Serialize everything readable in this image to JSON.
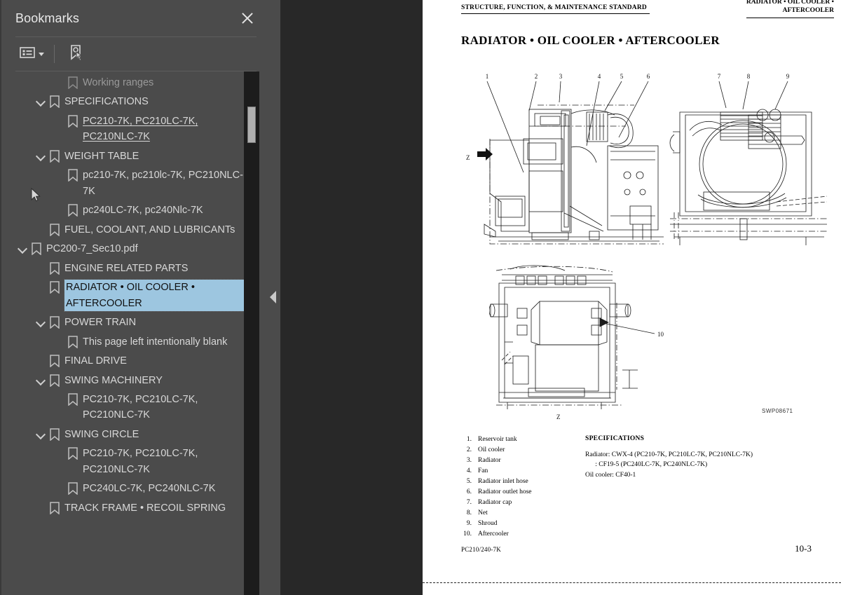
{
  "panel": {
    "title": "Bookmarks",
    "close_icon": "close-icon",
    "toolbar": {
      "options_icon": "list-options-icon",
      "options_chevron": "chevron-down-icon",
      "new_bookmark_icon": "new-bookmark-icon"
    }
  },
  "tree": [
    {
      "label": "Working ranges",
      "level": 1,
      "twisty": false,
      "selected": false,
      "underline": false,
      "faded": true
    },
    {
      "label": "SPECIFICATIONS",
      "level": 0,
      "twisty": true,
      "selected": false,
      "underline": false,
      "faded": false
    },
    {
      "label": "PC210-7K, PC210LC-7K, PC210NLC-7K",
      "level": 1,
      "twisty": false,
      "selected": false,
      "underline": true,
      "faded": false
    },
    {
      "label": "WEIGHT TABLE",
      "level": 0,
      "twisty": true,
      "selected": false,
      "underline": false,
      "faded": false
    },
    {
      "label": "pc210-7K, pc210lc-7K, PC210NLC-7K",
      "level": 1,
      "twisty": false,
      "selected": false,
      "underline": false,
      "faded": false
    },
    {
      "label": "pc240LC-7K, pc240Nlc-7K",
      "level": 1,
      "twisty": false,
      "selected": false,
      "underline": false,
      "faded": false
    },
    {
      "label": "FUEL, COOLANT, AND LUBRICANTs",
      "level": 0,
      "twisty": false,
      "selected": false,
      "underline": false,
      "faded": false
    },
    {
      "label": "PC200-7_Sec10.pdf",
      "level": -1,
      "twisty": true,
      "selected": false,
      "underline": false,
      "faded": false
    },
    {
      "label": "ENGINE RELATED PARTS",
      "level": 0,
      "twisty": false,
      "selected": false,
      "underline": false,
      "faded": false
    },
    {
      "label": "RADIATOR • OIL COOLER • AFTERCOOLER",
      "level": 0,
      "twisty": false,
      "selected": true,
      "underline": false,
      "faded": false
    },
    {
      "label": "POWER TRAIN",
      "level": 0,
      "twisty": true,
      "selected": false,
      "underline": false,
      "faded": false
    },
    {
      "label": "This page left intentionally blank",
      "level": 1,
      "twisty": false,
      "selected": false,
      "underline": false,
      "faded": false
    },
    {
      "label": "FINAL DRIVE",
      "level": 0,
      "twisty": false,
      "selected": false,
      "underline": false,
      "faded": false
    },
    {
      "label": "SWING MACHINERY",
      "level": 0,
      "twisty": true,
      "selected": false,
      "underline": false,
      "faded": false
    },
    {
      "label": "PC210-7K, PC210LC-7K, PC210NLC-7K",
      "level": 1,
      "twisty": false,
      "selected": false,
      "underline": false,
      "faded": false
    },
    {
      "label": "SWING CIRCLE",
      "level": 0,
      "twisty": true,
      "selected": false,
      "underline": false,
      "faded": false
    },
    {
      "label": "PC210-7K, PC210LC-7K, PC210NLC-7K",
      "level": 1,
      "twisty": false,
      "selected": false,
      "underline": false,
      "faded": false
    },
    {
      "label": "PC240LC-7K, PC240NLC-7K",
      "level": 1,
      "twisty": false,
      "selected": false,
      "underline": false,
      "faded": false
    },
    {
      "label": "TRACK FRAME • RECOIL SPRING",
      "level": 0,
      "twisty": false,
      "selected": false,
      "underline": false,
      "faded": false
    }
  ],
  "splitter": {
    "collapse_icon": "collapse-left-arrow-icon"
  },
  "page": {
    "header_left": "STRUCTURE, FUNCTION, & MAINTENANCE STANDARD",
    "header_right_line1": "RADIATOR • OIL COOLER •",
    "header_right_line2": "AFTERCOOLER",
    "title": "RADIATOR • OIL COOLER • AFTERCOOLER",
    "drawing_code": "SWP08671",
    "view_marker_left": "Z",
    "view_marker_bottom": "Z",
    "callouts_fig1": [
      "1",
      "2",
      "3",
      "4",
      "5",
      "6"
    ],
    "callouts_fig2": [
      "7",
      "8",
      "9"
    ],
    "callouts_fig3": [
      "10"
    ],
    "legend": [
      {
        "index": "1.",
        "text": "Reservoir tank"
      },
      {
        "index": "2.",
        "text": "Oil cooler"
      },
      {
        "index": "3.",
        "text": "Radiator"
      },
      {
        "index": "4.",
        "text": "Fan"
      },
      {
        "index": "5.",
        "text": "Radiator inlet hose"
      },
      {
        "index": "6.",
        "text": "Radiator outlet hose"
      },
      {
        "index": "7.",
        "text": "Radiator cap"
      },
      {
        "index": "8.",
        "text": "Net"
      },
      {
        "index": "9.",
        "text": "Shroud"
      },
      {
        "index": "10.",
        "text": "Aftercooler"
      }
    ],
    "specifications": {
      "heading": "SPECIFICATIONS",
      "lines": [
        "Radiator: CWX-4 (PC210-7K, PC210LC-7K, PC210NLC-7K)",
        "      : CF19-5 (PC240LC-7K, PC240NLC-7K)",
        "Oil cooler: CF40-1"
      ]
    },
    "footer_left": "PC210/240-7K",
    "footer_right": "10-3"
  },
  "colors": {
    "panel_bg": "#4b4b4b",
    "viewer_bg": "#282828",
    "selection": "#9dc6e0",
    "text": "#d8d8d8",
    "scrollbar_track": "#1c1c1c",
    "scrollbar_thumb": "#b0b0b0"
  }
}
